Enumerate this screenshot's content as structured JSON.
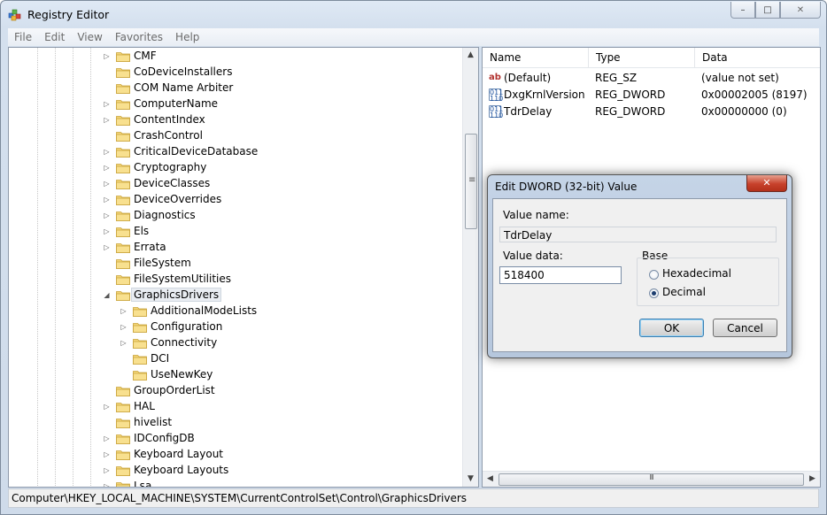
{
  "window": {
    "title": "Registry Editor",
    "minimize": "–",
    "maximize": "□",
    "close": "✕"
  },
  "menu": [
    "File",
    "Edit",
    "View",
    "Favorites",
    "Help"
  ],
  "tree": [
    {
      "label": "CMF",
      "expander": "▷",
      "indent": 0
    },
    {
      "label": "CoDeviceInstallers",
      "expander": "",
      "indent": 0
    },
    {
      "label": "COM Name Arbiter",
      "expander": "",
      "indent": 0
    },
    {
      "label": "ComputerName",
      "expander": "▷",
      "indent": 0
    },
    {
      "label": "ContentIndex",
      "expander": "▷",
      "indent": 0
    },
    {
      "label": "CrashControl",
      "expander": "",
      "indent": 0
    },
    {
      "label": "CriticalDeviceDatabase",
      "expander": "▷",
      "indent": 0
    },
    {
      "label": "Cryptography",
      "expander": "▷",
      "indent": 0
    },
    {
      "label": "DeviceClasses",
      "expander": "▷",
      "indent": 0
    },
    {
      "label": "DeviceOverrides",
      "expander": "▷",
      "indent": 0
    },
    {
      "label": "Diagnostics",
      "expander": "▷",
      "indent": 0
    },
    {
      "label": "Els",
      "expander": "▷",
      "indent": 0
    },
    {
      "label": "Errata",
      "expander": "▷",
      "indent": 0
    },
    {
      "label": "FileSystem",
      "expander": "",
      "indent": 0
    },
    {
      "label": "FileSystemUtilities",
      "expander": "",
      "indent": 0
    },
    {
      "label": "GraphicsDrivers",
      "expander": "◢",
      "indent": 0,
      "selected": true
    },
    {
      "label": "AdditionalModeLists",
      "expander": "▷",
      "indent": 1
    },
    {
      "label": "Configuration",
      "expander": "▷",
      "indent": 1
    },
    {
      "label": "Connectivity",
      "expander": "▷",
      "indent": 1
    },
    {
      "label": "DCI",
      "expander": "",
      "indent": 1
    },
    {
      "label": "UseNewKey",
      "expander": "",
      "indent": 1
    },
    {
      "label": "GroupOrderList",
      "expander": "",
      "indent": 0
    },
    {
      "label": "HAL",
      "expander": "▷",
      "indent": 0
    },
    {
      "label": "hivelist",
      "expander": "",
      "indent": 0
    },
    {
      "label": "IDConfigDB",
      "expander": "▷",
      "indent": 0
    },
    {
      "label": "Keyboard Layout",
      "expander": "▷",
      "indent": 0
    },
    {
      "label": "Keyboard Layouts",
      "expander": "▷",
      "indent": 0
    },
    {
      "label": "Lsa",
      "expander": "▷",
      "indent": 0
    }
  ],
  "values_pane": {
    "headers": {
      "name": "Name",
      "type": "Type",
      "data": "Data"
    },
    "rows": [
      {
        "icon": "string-value-icon",
        "glyph": "ab",
        "name": "(Default)",
        "type": "REG_SZ",
        "data": "(value not set)"
      },
      {
        "icon": "binary-value-icon",
        "glyph": "011 110",
        "name": "DxgKrnlVersion",
        "type": "REG_DWORD",
        "data": "0x00002005 (8197)"
      },
      {
        "icon": "binary-value-icon",
        "glyph": "011 110",
        "name": "TdrDelay",
        "type": "REG_DWORD",
        "data": "0x00000000 (0)"
      }
    ]
  },
  "scroll": {
    "up": "▲",
    "down": "▼",
    "left": "◀",
    "right": "▶",
    "grip": "≡",
    "hgrip": "III"
  },
  "status": "Computer\\HKEY_LOCAL_MACHINE\\SYSTEM\\CurrentControlSet\\Control\\GraphicsDrivers",
  "dialog": {
    "title": "Edit DWORD (32-bit) Value",
    "close": "✕",
    "value_name_label": "Value name:",
    "value_name": "TdrDelay",
    "value_data_label": "Value data:",
    "value_data": "518400",
    "base_label": "Base",
    "hex_label": "Hexadecimal",
    "dec_label": "Decimal",
    "base_selected": "Decimal",
    "ok": "OK",
    "cancel": "Cancel"
  }
}
